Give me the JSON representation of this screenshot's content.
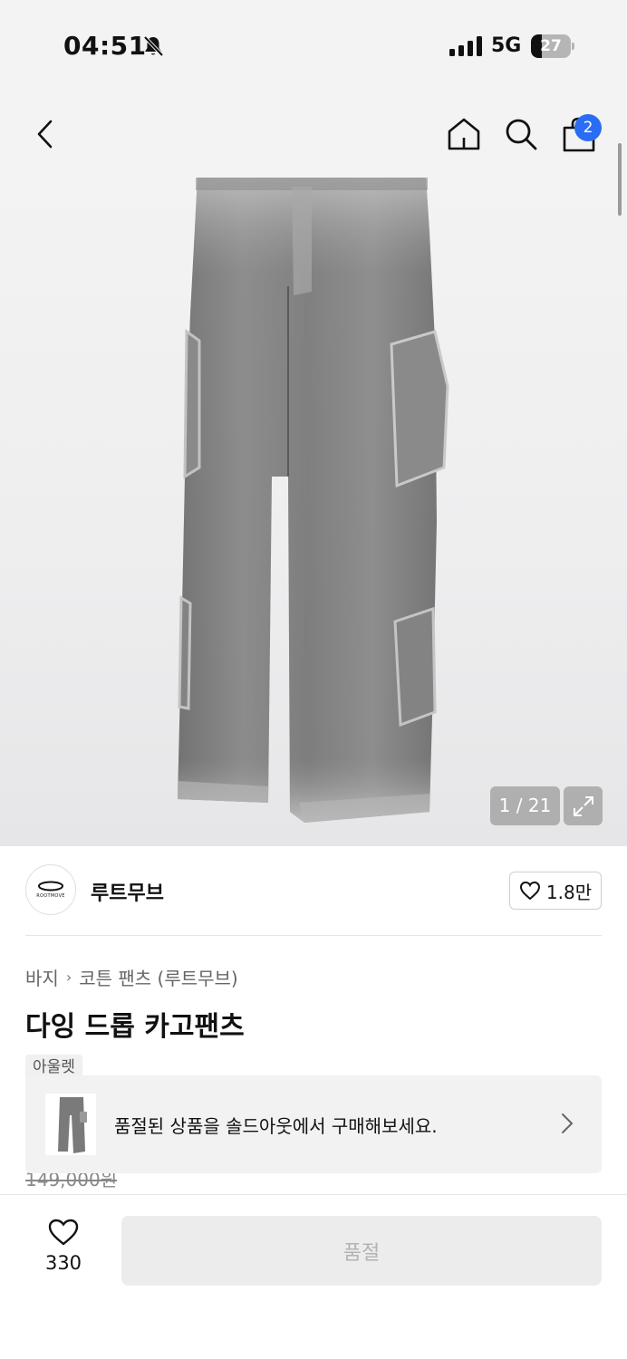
{
  "status_bar": {
    "time": "04:51",
    "network": "5G",
    "battery": "27",
    "battery_level": 0.27
  },
  "nav": {
    "back_icon": "chevron-left-icon",
    "home_icon": "home-icon",
    "search_icon": "search-icon",
    "cart_icon": "shopping-bag-icon",
    "cart_count": "2",
    "badge_color": "#2a6df4"
  },
  "gallery": {
    "counter": "1 / 21",
    "expand_icon": "expand-icon"
  },
  "brand": {
    "name": "루트무브",
    "logo_text": "ROOTMOVE",
    "likes": "1.8만"
  },
  "breadcrumb": {
    "category": "바지",
    "subcategory": "코튼 팬츠 (루트무브)"
  },
  "product": {
    "title": "다잉 드롭 카고팬츠",
    "outlet_tag": "아울렛",
    "original_price": "149,000원"
  },
  "soldout_banner": {
    "message": "품절된 상품을 솔드아웃에서 구매해보세요."
  },
  "bottom_bar": {
    "wish_count": "330",
    "purchase_label": "품절"
  }
}
